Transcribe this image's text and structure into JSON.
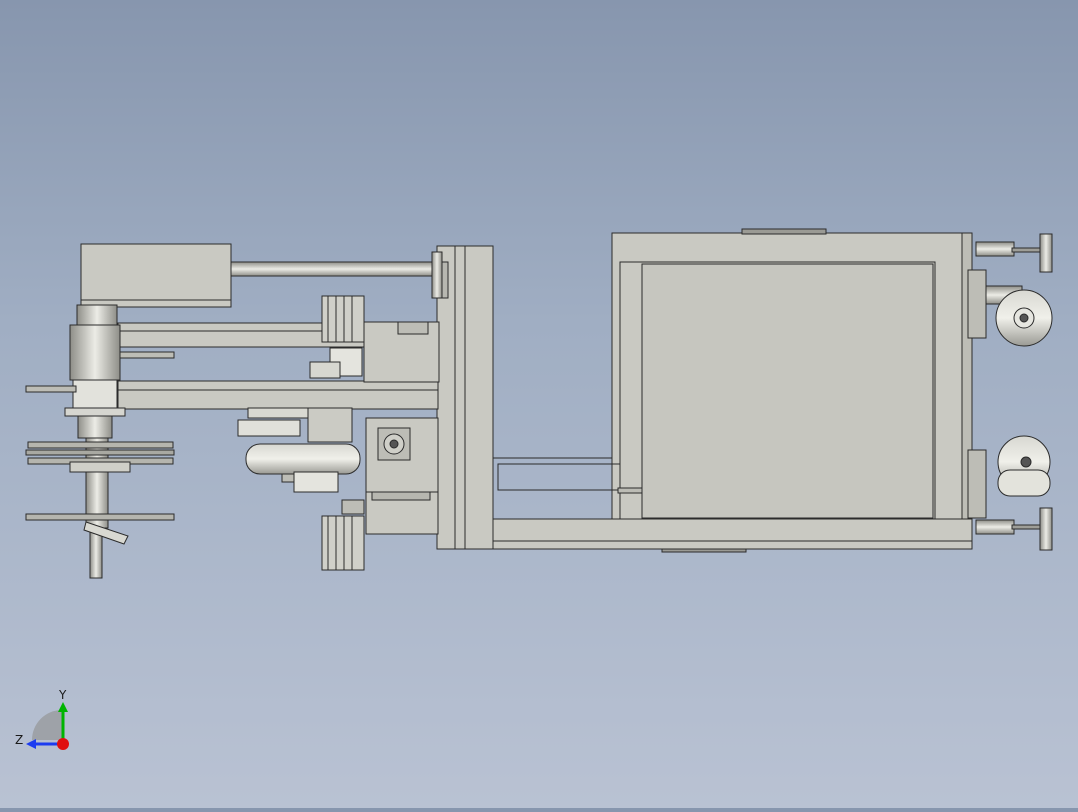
{
  "viewport": {
    "background_top": "#8796ae",
    "background_bottom": "#b9c2d3",
    "part_fill": "#c9c9c2",
    "part_stroke": "#2b2b2b"
  },
  "triad": {
    "y_label": "Y",
    "z_label": "Z",
    "y_color": "#00b400",
    "z_color": "#1c3cf0",
    "x_color": "#e01010"
  }
}
